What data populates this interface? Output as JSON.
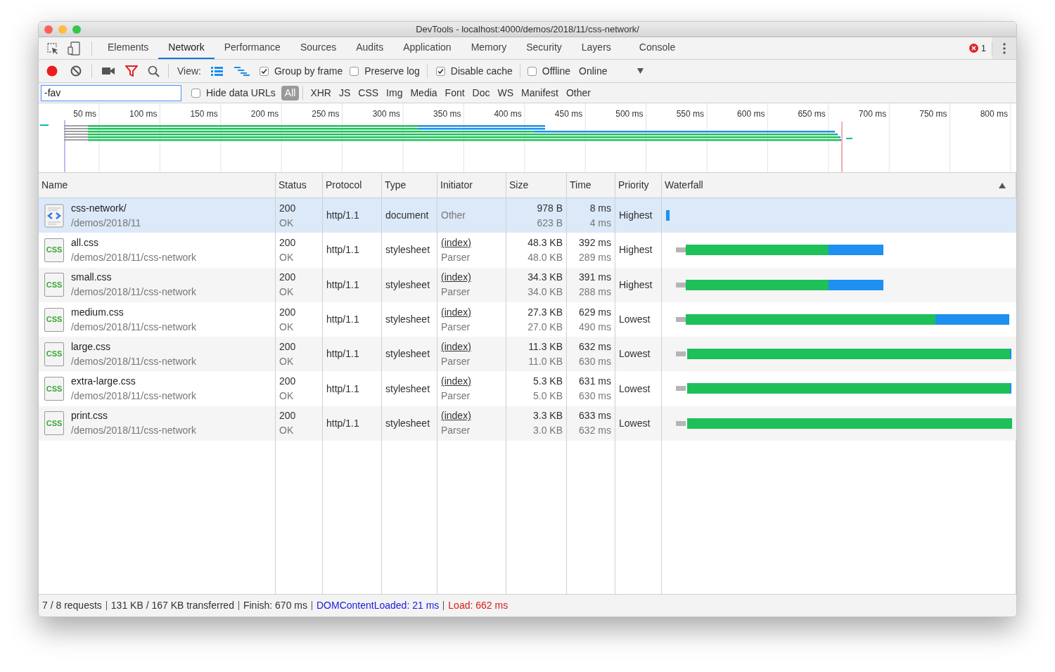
{
  "window": {
    "title": "DevTools - localhost:4000/demos/2018/11/css-network/"
  },
  "tabs": [
    {
      "label": "Elements",
      "selected": false
    },
    {
      "label": "Network",
      "selected": true
    },
    {
      "label": "Performance",
      "selected": false
    },
    {
      "label": "Sources",
      "selected": false
    },
    {
      "label": "Audits",
      "selected": false
    },
    {
      "label": "Application",
      "selected": false
    },
    {
      "label": "Memory",
      "selected": false
    },
    {
      "label": "Security",
      "selected": false
    },
    {
      "label": "Layers",
      "selected": false
    },
    {
      "label": "Console",
      "selected": false
    }
  ],
  "error_count": "1",
  "toolbar": {
    "view_label": "View:",
    "checkboxes": [
      {
        "label": "Group by frame",
        "checked": true
      },
      {
        "label": "Preserve log",
        "checked": false
      },
      {
        "label": "Disable cache",
        "checked": true
      },
      {
        "label": "Offline",
        "checked": false
      }
    ],
    "throttle": "Online"
  },
  "filter": {
    "value": "-fav",
    "hide_data_urls": {
      "label": "Hide data URLs",
      "checked": false
    },
    "types": [
      {
        "label": "All",
        "selected": true
      },
      {
        "label": "XHR",
        "selected": false
      },
      {
        "label": "JS",
        "selected": false
      },
      {
        "label": "CSS",
        "selected": false
      },
      {
        "label": "Img",
        "selected": false
      },
      {
        "label": "Media",
        "selected": false
      },
      {
        "label": "Font",
        "selected": false
      },
      {
        "label": "Doc",
        "selected": false
      },
      {
        "label": "WS",
        "selected": false
      },
      {
        "label": "Manifest",
        "selected": false
      },
      {
        "label": "Other",
        "selected": false
      }
    ]
  },
  "overview": {
    "ticks": [
      "50 ms",
      "100 ms",
      "150 ms",
      "200 ms",
      "250 ms",
      "300 ms",
      "350 ms",
      "400 ms",
      "450 ms",
      "500 ms",
      "550 ms",
      "600 ms",
      "650 ms",
      "700 ms",
      "750 ms",
      "800 ms"
    ]
  },
  "table": {
    "columns": [
      "Name",
      "Status",
      "Protocol",
      "Type",
      "Initiator",
      "Size",
      "Time",
      "Priority",
      "Waterfall"
    ],
    "rows": [
      {
        "kind": "document",
        "selected": true,
        "name": "css-network/",
        "path": "/demos/2018/11",
        "status": "200",
        "status_text": "OK",
        "protocol": "http/1.1",
        "type": "document",
        "initiator": "Other",
        "size": "978 B",
        "resource_size": "623 B",
        "time": "8 ms",
        "latency": "4 ms",
        "priority": "Highest"
      },
      {
        "kind": "stylesheet",
        "icon_text": "CSS",
        "selected": false,
        "name": "all.css",
        "path": "/demos/2018/11/css-network",
        "status": "200",
        "status_text": "OK",
        "protocol": "http/1.1",
        "type": "stylesheet",
        "initiator": "(index)",
        "initiator_detail": "Parser",
        "size": "48.3 KB",
        "resource_size": "48.0 KB",
        "time": "392 ms",
        "latency": "289 ms",
        "priority": "Highest"
      },
      {
        "kind": "stylesheet",
        "icon_text": "CSS",
        "selected": false,
        "name": "small.css",
        "path": "/demos/2018/11/css-network",
        "status": "200",
        "status_text": "OK",
        "protocol": "http/1.1",
        "type": "stylesheet",
        "initiator": "(index)",
        "initiator_detail": "Parser",
        "size": "34.3 KB",
        "resource_size": "34.0 KB",
        "time": "391 ms",
        "latency": "288 ms",
        "priority": "Highest"
      },
      {
        "kind": "stylesheet",
        "icon_text": "CSS",
        "selected": false,
        "name": "medium.css",
        "path": "/demos/2018/11/css-network",
        "status": "200",
        "status_text": "OK",
        "protocol": "http/1.1",
        "type": "stylesheet",
        "initiator": "(index)",
        "initiator_detail": "Parser",
        "size": "27.3 KB",
        "resource_size": "27.0 KB",
        "time": "629 ms",
        "latency": "490 ms",
        "priority": "Lowest"
      },
      {
        "kind": "stylesheet",
        "icon_text": "CSS",
        "selected": false,
        "name": "large.css",
        "path": "/demos/2018/11/css-network",
        "status": "200",
        "status_text": "OK",
        "protocol": "http/1.1",
        "type": "stylesheet",
        "initiator": "(index)",
        "initiator_detail": "Parser",
        "size": "11.3 KB",
        "resource_size": "11.0 KB",
        "time": "632 ms",
        "latency": "630 ms",
        "priority": "Lowest"
      },
      {
        "kind": "stylesheet",
        "icon_text": "CSS",
        "selected": false,
        "name": "extra-large.css",
        "path": "/demos/2018/11/css-network",
        "status": "200",
        "status_text": "OK",
        "protocol": "http/1.1",
        "type": "stylesheet",
        "initiator": "(index)",
        "initiator_detail": "Parser",
        "size": "5.3 KB",
        "resource_size": "5.0 KB",
        "time": "631 ms",
        "latency": "630 ms",
        "priority": "Lowest"
      },
      {
        "kind": "stylesheet",
        "icon_text": "CSS",
        "selected": false,
        "name": "print.css",
        "path": "/demos/2018/11/css-network",
        "status": "200",
        "status_text": "OK",
        "protocol": "http/1.1",
        "type": "stylesheet",
        "initiator": "(index)",
        "initiator_detail": "Parser",
        "size": "3.3 KB",
        "resource_size": "3.0 KB",
        "time": "633 ms",
        "latency": "632 ms",
        "priority": "Lowest"
      }
    ]
  },
  "status_bar": [
    {
      "kind": "plain",
      "text": "7 / 8 requests"
    },
    {
      "kind": "plain",
      "text": "131 KB / 167 KB transferred"
    },
    {
      "kind": "plain",
      "text": "Finish: 670 ms"
    },
    {
      "kind": "dom",
      "text": "DOMContentLoaded: 21 ms"
    },
    {
      "kind": "load",
      "text": "Load: 662 ms"
    }
  ]
}
